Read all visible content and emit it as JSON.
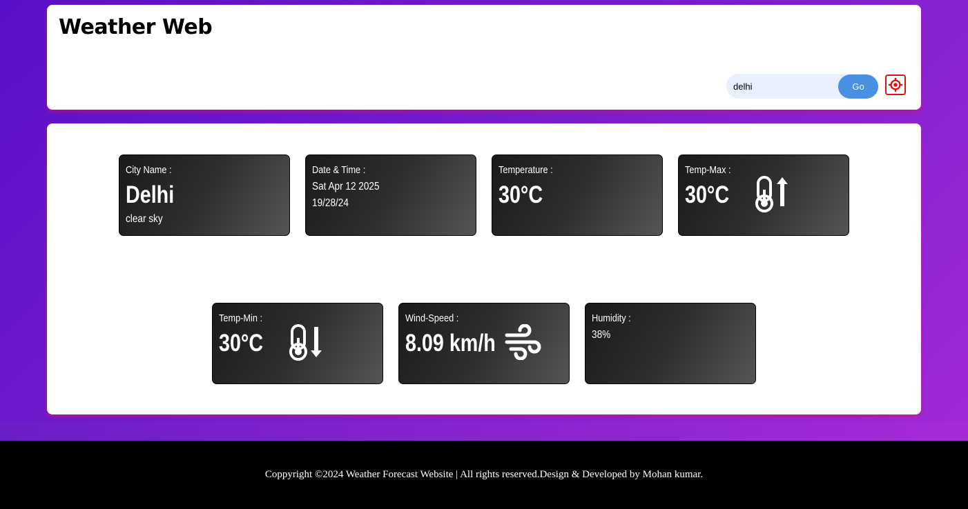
{
  "header": {
    "title": "Weather Web",
    "search_value": "delhi",
    "go_label": "Go",
    "location_icon": "crosshair-icon"
  },
  "cards": {
    "city": {
      "label": "City Name :",
      "name": "Delhi",
      "description": "clear sky"
    },
    "datetime": {
      "label": "Date & Time :",
      "date": "Sat Apr 12 2025",
      "time": "19/28/24"
    },
    "temperature": {
      "label": "Temperature :",
      "value": "30°C"
    },
    "temp_max": {
      "label": "Temp-Max :",
      "value": "30°C",
      "icon": "thermometer-up-icon"
    },
    "temp_min": {
      "label": "Temp-Min :",
      "value": "30°C",
      "icon": "thermometer-down-icon"
    },
    "wind": {
      "label": "Wind-Speed :",
      "value": "8.09 km/h",
      "icon": "wind-icon"
    },
    "humidity": {
      "label": "Humidity :",
      "value": "38%"
    }
  },
  "footer": {
    "text": "Coppyright ©2024 Weather Forecast Website | All rights reserved.Design & Developed by Mohan kumar."
  },
  "colors": {
    "accent": "#4a90e2",
    "location": "#e01010",
    "card_dark": "#1a1a1a",
    "background_start": "#5a0fc8",
    "background_end": "#a52ad8"
  }
}
